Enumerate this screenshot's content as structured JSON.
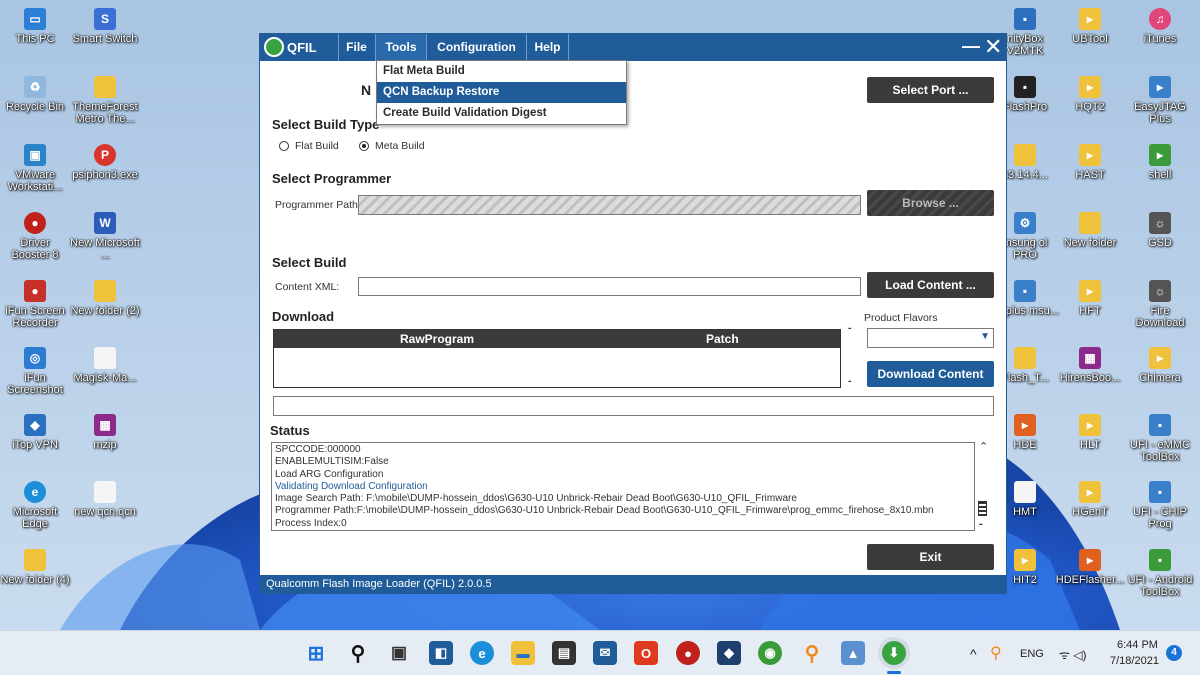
{
  "desktop": {
    "icons": [
      {
        "label": "This PC",
        "color": "#2b7fd4",
        "glyph": "▭"
      },
      {
        "label": "Smart Switch",
        "color": "#3b6fd6",
        "glyph": "S"
      },
      {
        "label": "Recycle Bin",
        "color": "#8fb8e0",
        "glyph": "♻"
      },
      {
        "label": "ThemeForest Metro The...",
        "color": "#f0c23c",
        "glyph": ""
      },
      {
        "label": "VMware Workstati...",
        "color": "#2a83c9",
        "glyph": "▣"
      },
      {
        "label": "psiphon3.exe",
        "color": "#d9352c",
        "glyph": "P"
      },
      {
        "label": "Driver Booster 8",
        "color": "#c0221b",
        "glyph": "●"
      },
      {
        "label": "New Microsoft ...",
        "color": "#2b5eb8",
        "glyph": "W"
      },
      {
        "label": "iFun Screen Recorder",
        "color": "#c8302a",
        "glyph": "●"
      },
      {
        "label": "New folder (2)",
        "color": "#f0c23c",
        "glyph": ""
      },
      {
        "label": "iFun Screenshot",
        "color": "#2c7bd1",
        "glyph": "◎"
      },
      {
        "label": "Magisk-Ma...",
        "color": "#f5f5f5",
        "glyph": ""
      },
      {
        "label": "iTop VPN",
        "color": "#2a6fc0",
        "glyph": "◆"
      },
      {
        "label": "mzip",
        "color": "#8c2a8c",
        "glyph": "▦"
      },
      {
        "label": "Microsoft Edge",
        "color": "#1b8fd8",
        "glyph": "e"
      },
      {
        "label": "new qcn.qcn",
        "color": "#f5f5f5",
        "glyph": ""
      },
      {
        "label": "New folder (4)",
        "color": "#f0c23c",
        "glyph": ""
      },
      {
        "label": "nityBox V2MTK",
        "color": "#2c6fbf",
        "glyph": "▪"
      },
      {
        "label": "UBTool",
        "color": "#f0c23c",
        "glyph": "▸"
      },
      {
        "label": "iTunes",
        "color": "#e0457b",
        "glyph": "♫"
      },
      {
        "label": "FlashPro",
        "color": "#222222",
        "glyph": "▪"
      },
      {
        "label": "HQT2",
        "color": "#f0c23c",
        "glyph": "▸"
      },
      {
        "label": "EasyJTAG Plus",
        "color": "#3a7fc9",
        "glyph": "▸"
      },
      {
        "label": "n3.14.4...",
        "color": "#f0c23c",
        "glyph": ""
      },
      {
        "label": "HAST",
        "color": "#f0c23c",
        "glyph": "▸"
      },
      {
        "label": "shell",
        "color": "#3b9b3b",
        "glyph": "▸"
      },
      {
        "label": "msung ol PRO",
        "color": "#3a7fc9",
        "glyph": "⚙"
      },
      {
        "label": "New folder",
        "color": "#f0c23c",
        "glyph": ""
      },
      {
        "label": "GSD",
        "color": "#555555",
        "glyph": "☼"
      },
      {
        "label": "ctoplus msu...",
        "color": "#3a7fc9",
        "glyph": "▪"
      },
      {
        "label": "HFT",
        "color": "#f0c23c",
        "glyph": "▸"
      },
      {
        "label": "Fire Download",
        "color": "#555555",
        "glyph": "☼"
      },
      {
        "label": "Flash_T...",
        "color": "#f0c23c",
        "glyph": ""
      },
      {
        "label": "HirensBoo...",
        "color": "#8c2a8c",
        "glyph": "▦"
      },
      {
        "label": "Chimera",
        "color": "#f0c23c",
        "glyph": "▸"
      },
      {
        "label": "HDE",
        "color": "#e06020",
        "glyph": "▸"
      },
      {
        "label": "HLT",
        "color": "#f0c23c",
        "glyph": "▸"
      },
      {
        "label": "UFI - eMMC ToolBox",
        "color": "#3a7fc9",
        "glyph": "▪"
      },
      {
        "label": "HMT",
        "color": "#f5f5f5",
        "glyph": ""
      },
      {
        "label": "HGenT",
        "color": "#f0c23c",
        "glyph": "▸"
      },
      {
        "label": "UFI - CHIP Prog",
        "color": "#3a7fc9",
        "glyph": "▪"
      },
      {
        "label": "HIT2",
        "color": "#f0c23c",
        "glyph": "▸"
      },
      {
        "label": "HDEFlasher...",
        "color": "#e06020",
        "glyph": "▸"
      },
      {
        "label": "UFI - Android ToolBox",
        "color": "#3b9b3b",
        "glyph": "▪"
      }
    ]
  },
  "window": {
    "title": "QFIL",
    "menu": [
      "File",
      "Tools",
      "Configuration",
      "Help"
    ],
    "min_glyph": "—",
    "close_glyph": "✕",
    "tools_menu": [
      "Flat Meta Build",
      "QCN Backup Restore",
      "Create Build Validation Digest"
    ],
    "port_label_partial": "N",
    "select_port": "Select Port ...",
    "build_type_title": "Select Build Type",
    "flat_build": "Flat Build",
    "meta_build": "Meta Build",
    "programmer_title": "Select Programmer",
    "programmer_path_label": "Programmer Path",
    "browse": "Browse ...",
    "select_build_title": "Select Build",
    "content_xml_label": "Content XML:",
    "load_content": "Load Content ...",
    "download_title": "Download",
    "col_rawprogram": "RawProgram",
    "col_patch": "Patch",
    "dash1": "-",
    "dash2": "-",
    "product_flavors": "Product Flavors",
    "download_content": "Download Content",
    "status_title": "Status",
    "status_lines": [
      {
        "text": "SPCCODE:000000",
        "blue": false
      },
      {
        "text": "ENABLEMULTISIM:False",
        "blue": false
      },
      {
        "text": "Load ARG Configuration",
        "blue": false
      },
      {
        "text": "Validating Download Configuration",
        "blue": true
      },
      {
        "text": "Image Search Path: F:\\mobile\\DUMP-hossein_ddos\\G630-U10 Unbrick-Rebair Dead Boot\\G630-U10_QFIL_Frimware",
        "blue": false
      },
      {
        "text": "Programmer Path:F:\\mobile\\DUMP-hossein_ddos\\G630-U10 Unbrick-Rebair Dead Boot\\G630-U10_QFIL_Frimware\\prog_emmc_firehose_8x10.mbn",
        "blue": false
      },
      {
        "text": "Process Index:0",
        "blue": false
      }
    ],
    "exit": "Exit",
    "footer": "Qualcomm Flash Image Loader (QFIL)    2.0.0.5"
  },
  "taskbar": {
    "apps": [
      {
        "name": "start",
        "color": "#1a73d9",
        "glyph": "⊞"
      },
      {
        "name": "search",
        "color": "#e6ecf4",
        "glyph": "⚲"
      },
      {
        "name": "task-view",
        "color": "#333333",
        "glyph": "▣"
      },
      {
        "name": "widgets",
        "color": "#1f5c99",
        "glyph": "◧"
      },
      {
        "name": "edge",
        "color": "#1b8fd8",
        "glyph": "e"
      },
      {
        "name": "file-explorer",
        "color": "#f0c23c",
        "glyph": "▬"
      },
      {
        "name": "store",
        "color": "#333333",
        "glyph": "▤"
      },
      {
        "name": "mail",
        "color": "#1f5c99",
        "glyph": "✉"
      },
      {
        "name": "office",
        "color": "#e03a1e",
        "glyph": "O"
      },
      {
        "name": "driver-booster",
        "color": "#c0221b",
        "glyph": "●"
      },
      {
        "name": "itop-vpn",
        "color": "#1f3f6f",
        "glyph": "◆"
      },
      {
        "name": "chrome",
        "color": "#3b9b3b",
        "glyph": "◉"
      },
      {
        "name": "search-app",
        "color": "#f08a1c",
        "glyph": "⚲"
      },
      {
        "name": "photos",
        "color": "#5b8fd0",
        "glyph": "▲"
      },
      {
        "name": "qfil",
        "color": "#3aa341",
        "glyph": "⬇"
      }
    ],
    "tray_up": "^",
    "lang": "ENG",
    "wifi_sound": "ᯤ ◁)",
    "time": "6:44 PM",
    "date": "7/18/2021",
    "notifications": "4"
  }
}
